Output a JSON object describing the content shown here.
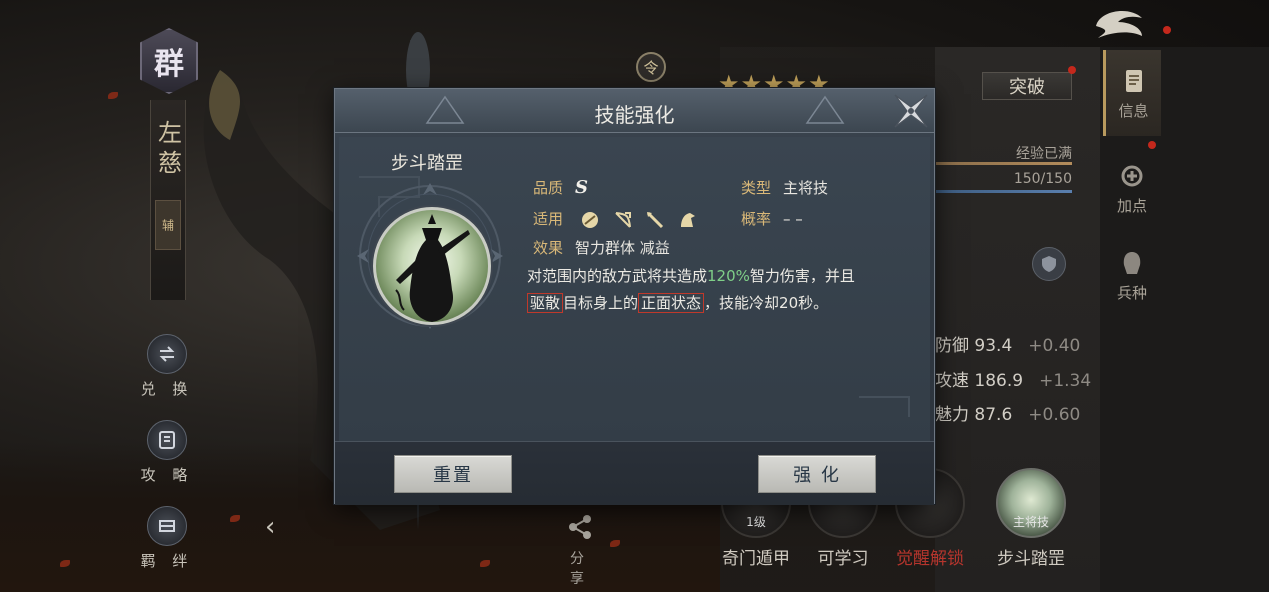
{
  "hero": {
    "faction_char": "群",
    "name": "左慈",
    "role": "辅"
  },
  "left_buttons": [
    {
      "label": "兑 换",
      "icon": "exchange-icon"
    },
    {
      "label": "攻 略",
      "icon": "guide-icon"
    },
    {
      "label": "羁 绊",
      "icon": "bond-icon"
    }
  ],
  "share": {
    "label": "分 享",
    "icon": "share-icon"
  },
  "order_badge": "令",
  "stars": "★★★★★",
  "breakthrough_label": "突破",
  "exp": {
    "label": "经验已满",
    "value": "150/150"
  },
  "stats": [
    {
      "label": "防御 93.4",
      "inc": "+0.40"
    },
    {
      "label": "攻速 186.9",
      "inc": "+1.34"
    },
    {
      "label": "魅力 87.6",
      "inc": "+0.60"
    }
  ],
  "tabs": [
    {
      "label": "信息",
      "icon": "scroll-icon",
      "active": true
    },
    {
      "label": "加点",
      "icon": "points-icon",
      "active": false
    },
    {
      "label": "兵种",
      "icon": "troop-icon",
      "active": false
    }
  ],
  "bottom_skills": [
    {
      "label": "奇门遁甲",
      "tag": "1级"
    },
    {
      "label": "可学习",
      "tag": ""
    },
    {
      "label": "觉醒解锁",
      "tag": ""
    },
    {
      "label": "步斗踏罡",
      "tag": "主将技"
    }
  ],
  "modal": {
    "title": "技能强化",
    "skill_name": "步斗踏罡",
    "quality_label": "品质",
    "quality_value": "S",
    "type_label": "类型",
    "type_value": "主将技",
    "applies_label": "适用",
    "applies_icons": [
      "shield-unit-icon",
      "bow-unit-icon",
      "spear-unit-icon",
      "cavalry-unit-icon"
    ],
    "rate_label": "概率",
    "rate_value": "– –",
    "effect_label": "效果",
    "effect_value": "智力群体 减益",
    "desc": {
      "p1": "对范围内的敌方武将共造成",
      "pct": "120%",
      "p2": "智力伤害，并且",
      "kw1": "驱散",
      "p3": "目标身上的",
      "kw2": "正面状态",
      "p4": "，技能冷却20秒。"
    },
    "reset_label": "重置",
    "enhance_label": "强 化"
  },
  "colors": {
    "accent_gold": "#d9b878",
    "highlight_green": "#7fcf88",
    "keyword_border": "#c0392b"
  }
}
